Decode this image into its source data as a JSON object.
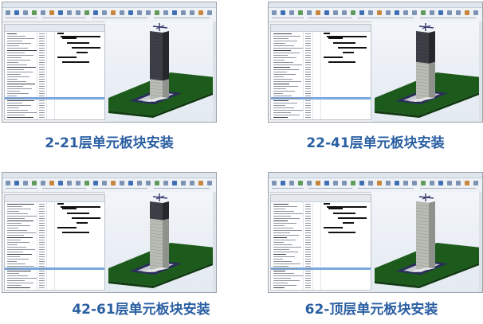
{
  "panels": [
    {
      "id": "p1",
      "caption": "2-21层单元板块安装",
      "progress": 0.3
    },
    {
      "id": "p2",
      "caption": "22-41层单元板块安装",
      "progress": 0.55
    },
    {
      "id": "p3",
      "caption": "42-61层单元板块安装",
      "progress": 0.75
    },
    {
      "id": "p4",
      "caption": "62-顶层单元板块安装",
      "progress": 1.0
    }
  ],
  "colors": {
    "caption": "#2a5fa2",
    "ground": "#1c5a1c",
    "tower_dark": "#3d4047",
    "tower_light": "#b9bdb6",
    "selection": "#7aa7df"
  },
  "icons": [
    "ribbon-icon",
    "crane-icon"
  ]
}
